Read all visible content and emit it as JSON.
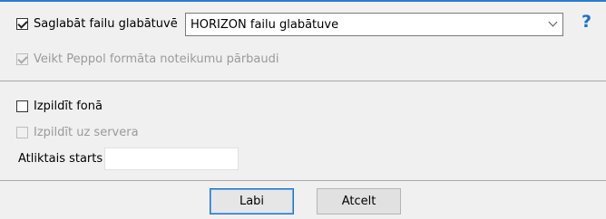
{
  "storage": {
    "checkbox_label": "Saglabāt failu glabātuvē",
    "checked": true,
    "select_value": "HORIZON failu glabātuve",
    "help_symbol": "?"
  },
  "peppol": {
    "checkbox_label": "Veikt Peppol formāta noteikumu pārbaudi",
    "checked": true,
    "disabled": true
  },
  "background": {
    "checkbox_label": "Izpildīt fonā",
    "checked": false
  },
  "server": {
    "checkbox_label": "Izpildīt uz servera",
    "checked": false,
    "disabled": true
  },
  "delayed_start": {
    "label": "Atliktais starts",
    "value": ""
  },
  "buttons": {
    "ok": "Labi",
    "cancel": "Atcelt"
  },
  "colors": {
    "accent": "#1a6fd1",
    "background": "#f0f0f0"
  }
}
